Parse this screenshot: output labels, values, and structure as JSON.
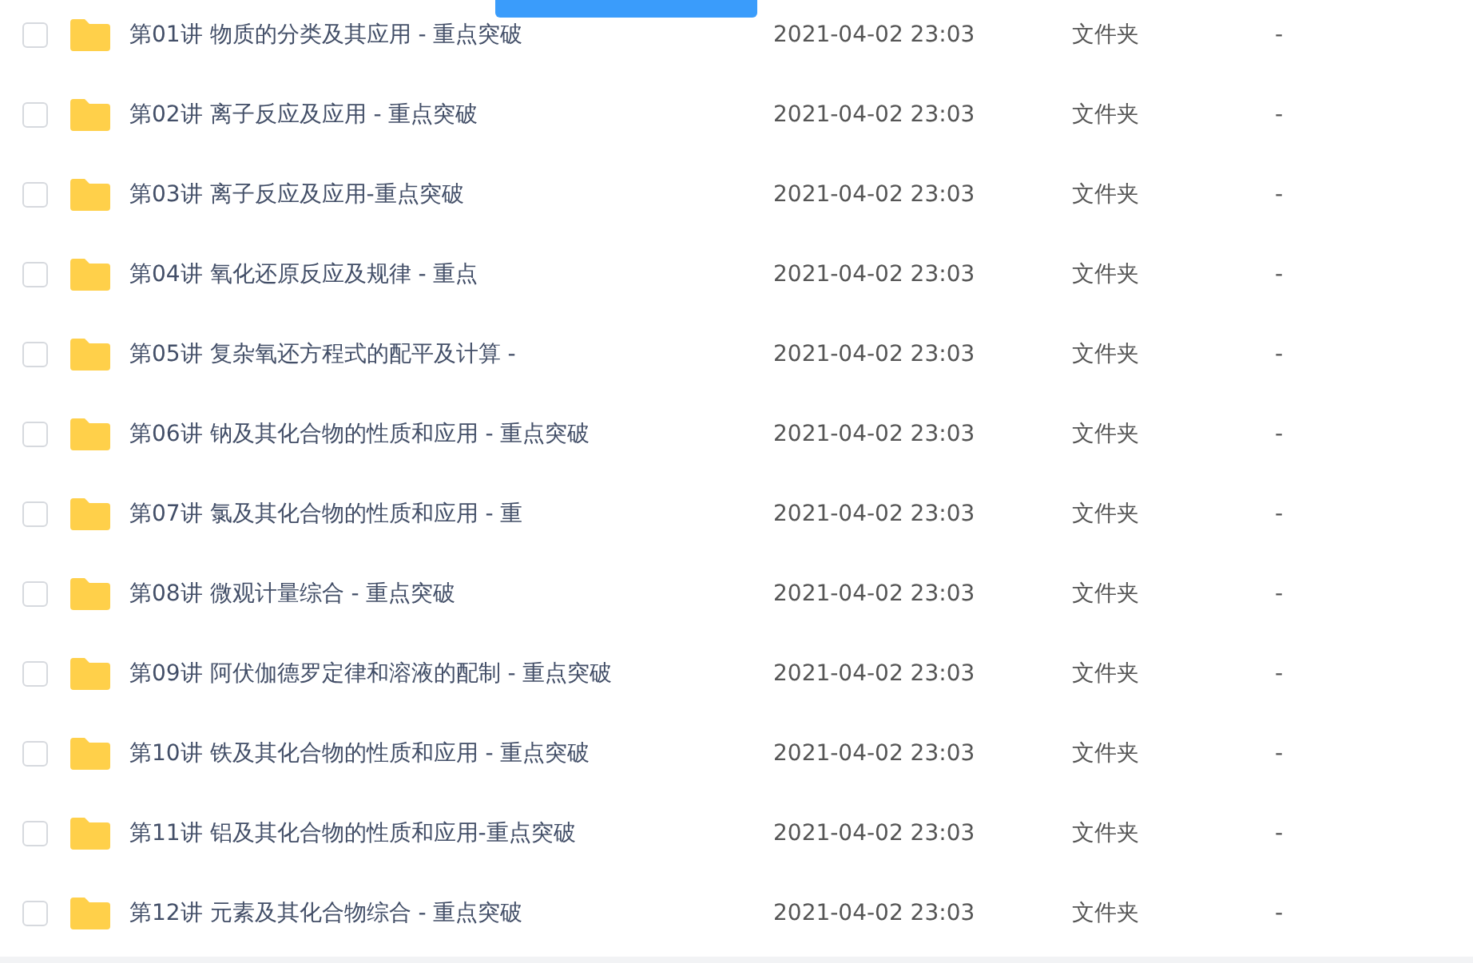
{
  "files": [
    {
      "name": "第01讲 物质的分类及其应用 - 重点突破",
      "modified": "2021-04-02 23:03",
      "type": "文件夹",
      "size": "-",
      "checked": false
    },
    {
      "name": "第02讲 离子反应及应用 - 重点突破",
      "modified": "2021-04-02 23:03",
      "type": "文件夹",
      "size": "-",
      "checked": false
    },
    {
      "name": "第03讲 离子反应及应用-重点突破",
      "modified": "2021-04-02 23:03",
      "type": "文件夹",
      "size": "-",
      "checked": false
    },
    {
      "name": "第04讲 氧化还原反应及规律 - 重点",
      "modified": "2021-04-02 23:03",
      "type": "文件夹",
      "size": "-",
      "checked": false
    },
    {
      "name": "第05讲 复杂氧还方程式的配平及计算 -",
      "modified": "2021-04-02 23:03",
      "type": "文件夹",
      "size": "-",
      "checked": false
    },
    {
      "name": "第06讲 钠及其化合物的性质和应用 - 重点突破",
      "modified": "2021-04-02 23:03",
      "type": "文件夹",
      "size": "-",
      "checked": false
    },
    {
      "name": "第07讲 氯及其化合物的性质和应用 - 重",
      "modified": "2021-04-02 23:03",
      "type": "文件夹",
      "size": "-",
      "checked": false
    },
    {
      "name": "第08讲 微观计量综合 - 重点突破",
      "modified": "2021-04-02 23:03",
      "type": "文件夹",
      "size": "-",
      "checked": false
    },
    {
      "name": "第09讲 阿伏伽德罗定律和溶液的配制 - 重点突破",
      "modified": "2021-04-02 23:03",
      "type": "文件夹",
      "size": "-",
      "checked": false
    },
    {
      "name": "第10讲 铁及其化合物的性质和应用 - 重点突破",
      "modified": "2021-04-02 23:03",
      "type": "文件夹",
      "size": "-",
      "checked": false
    },
    {
      "name": "第11讲 铝及其化合物的性质和应用-重点突破",
      "modified": "2021-04-02 23:03",
      "type": "文件夹",
      "size": "-",
      "checked": false
    },
    {
      "name": "第12讲 元素及其化合物综合 - 重点突破",
      "modified": "2021-04-02 23:03",
      "type": "文件夹",
      "size": "-",
      "checked": false
    }
  ]
}
